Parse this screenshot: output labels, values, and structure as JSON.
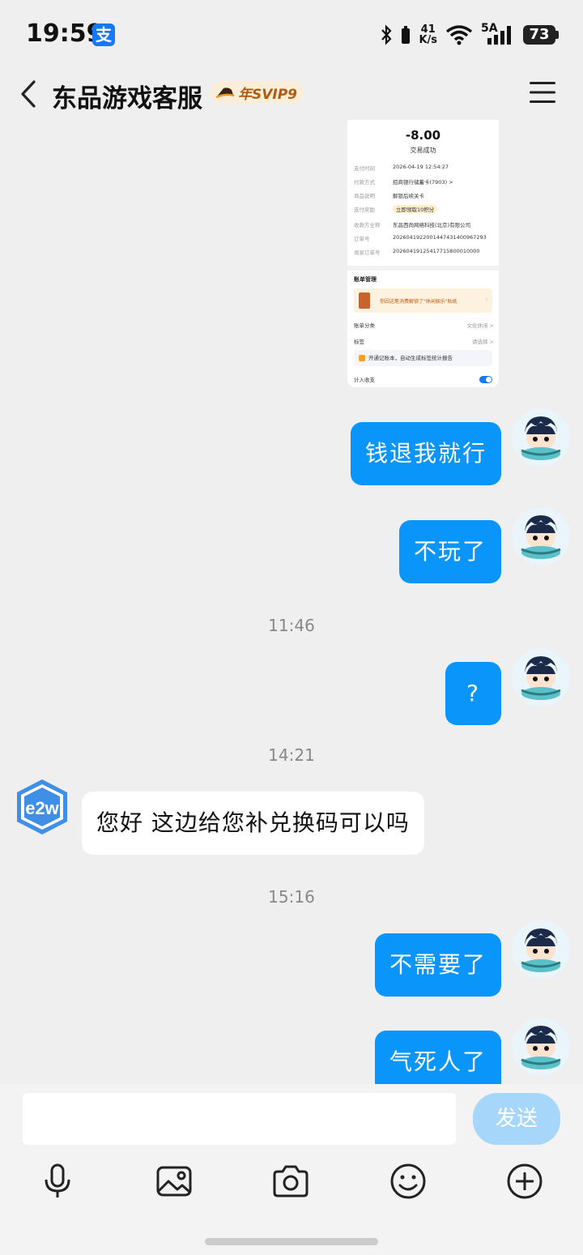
{
  "status_bar": {
    "time": "19:59",
    "app_badge": "支",
    "net_speed_value": "41",
    "net_speed_unit": "K/s",
    "signal_label": "5A",
    "battery": "73"
  },
  "header": {
    "title": "东品游戏客服",
    "vip_badge": "年SVIP9"
  },
  "receipt": {
    "amount": "-8.00",
    "status": "交易成功",
    "rows": [
      {
        "k": "支付时间",
        "v": "2026-04-19 12:54:27"
      },
      {
        "k": "付款方式",
        "v": "招商银行储蓄卡(7903) >"
      },
      {
        "k": "商品说明",
        "v": "解锁后续关卡"
      },
      {
        "k": "支付奖励",
        "v": "立即领取10积分"
      },
      {
        "k": "收款方全称",
        "v": "东昌西尚网络科技(北京)有限公司"
      },
      {
        "k": "订单号",
        "v": "2026041922001447431400967293"
      },
      {
        "k": "商家订单号",
        "v": "20260419125417715800010000"
      }
    ],
    "bill_mgmt": "账单管理",
    "banner_text": "你因这笔消费解锁了\"休闲娱乐\"贴纸",
    "category_label": "账单分类",
    "category_value": "文化休闲 >",
    "tag_label": "标签",
    "tag_value": "请选择 >",
    "tip_text": "开通记账本，自动生成标签统计报告",
    "include_label": "计入收支"
  },
  "messages": {
    "m1": "钱退我就行",
    "m2": "不玩了",
    "t1": "11:46",
    "m3": "?",
    "t2": "14:21",
    "m4": "您好 这边给您补兑换码可以吗",
    "t3": "15:16",
    "m5": "不需要了",
    "m6": "气死人了"
  },
  "agent_logo": "e2w",
  "input_bar": {
    "placeholder": "",
    "send_label": "发送"
  },
  "colors": {
    "outgoing_bubble": "#0a95fb",
    "send_button": "#a7d6fb",
    "background": "#efefef"
  }
}
